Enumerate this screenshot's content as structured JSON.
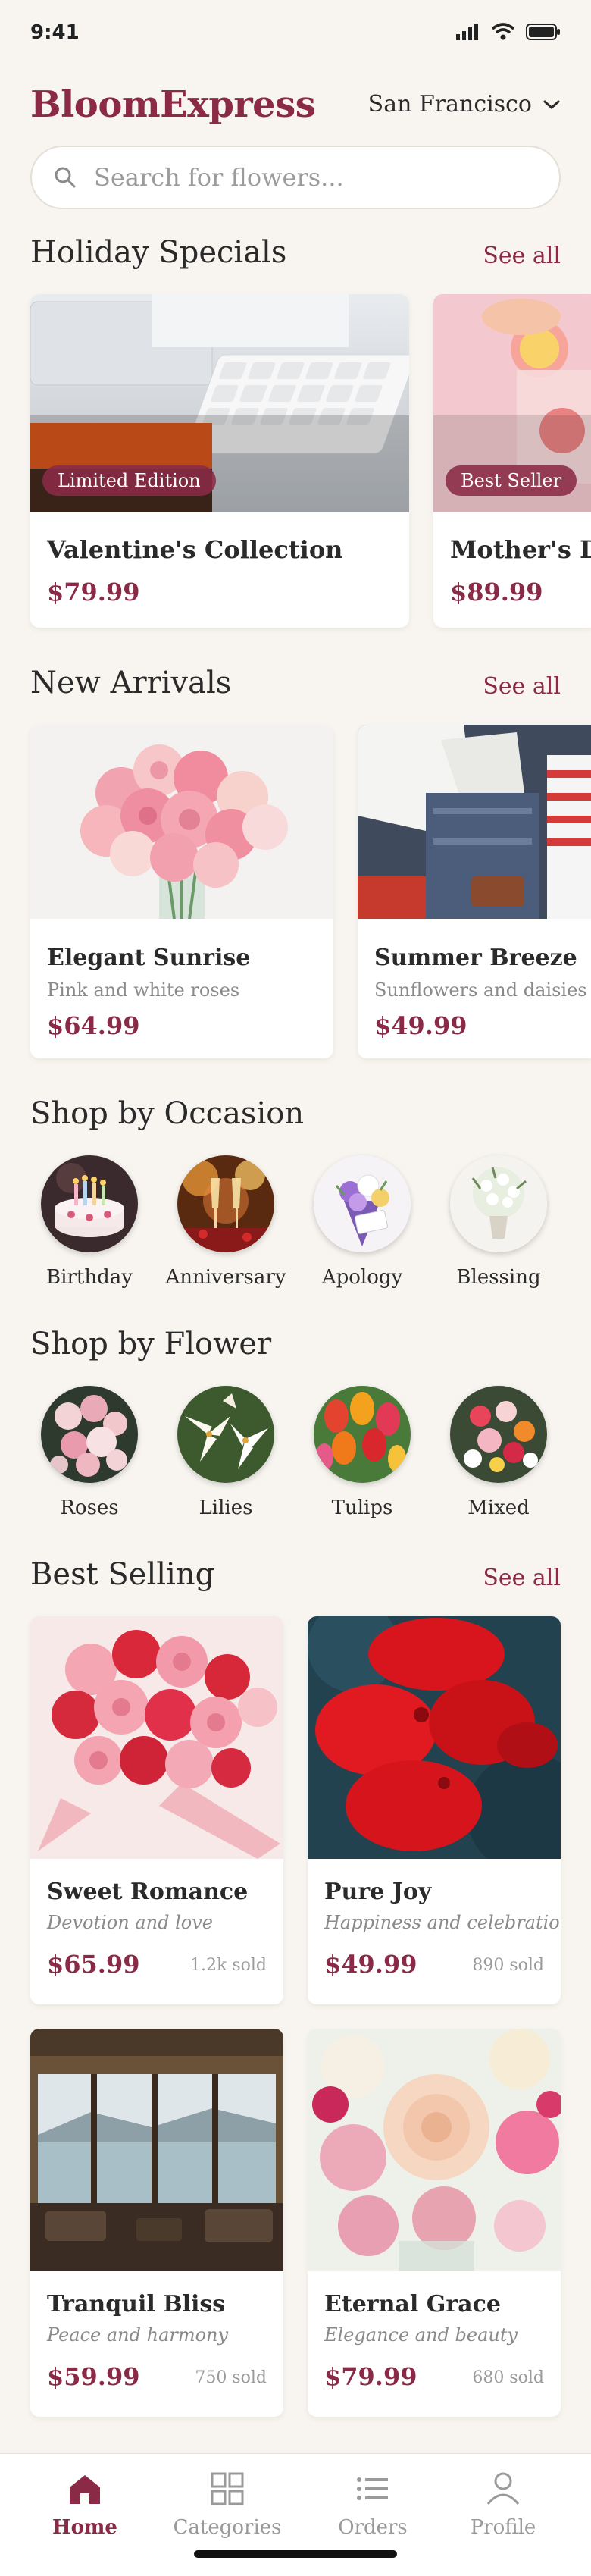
{
  "status": {
    "time": "9:41"
  },
  "header": {
    "brand": "BloomExpress",
    "location": "San Francisco"
  },
  "search": {
    "placeholder": "Search for flowers..."
  },
  "holiday": {
    "title": "Holiday Specials",
    "see_all": "See all",
    "items": [
      {
        "badge": "Limited Edition",
        "name": "Valentine's Collection",
        "price": "$79.99"
      },
      {
        "badge": "Best Seller",
        "name": "Mother's Day",
        "price": "$89.99"
      }
    ]
  },
  "arrivals": {
    "title": "New Arrivals",
    "see_all": "See all",
    "items": [
      {
        "name": "Elegant Sunrise",
        "desc": "Pink and white roses",
        "price": "$64.99"
      },
      {
        "name": "Summer Breeze",
        "desc": "Sunflowers and daisies",
        "price": "$49.99"
      }
    ]
  },
  "occasion": {
    "title": "Shop by Occasion",
    "items": [
      {
        "label": "Birthday"
      },
      {
        "label": "Anniversary"
      },
      {
        "label": "Apology"
      },
      {
        "label": "Blessing"
      }
    ]
  },
  "flower": {
    "title": "Shop by Flower",
    "items": [
      {
        "label": "Roses"
      },
      {
        "label": "Lilies"
      },
      {
        "label": "Tulips"
      },
      {
        "label": "Mixed"
      }
    ]
  },
  "best": {
    "title": "Best Selling",
    "see_all": "See all",
    "items": [
      {
        "name": "Sweet Romance",
        "tagline": "Devotion and love",
        "price": "$65.99",
        "sold": "1.2k sold"
      },
      {
        "name": "Pure Joy",
        "tagline": "Happiness and celebration",
        "price": "$49.99",
        "sold": "890 sold"
      },
      {
        "name": "Tranquil Bliss",
        "tagline": "Peace and harmony",
        "price": "$59.99",
        "sold": "750 sold"
      },
      {
        "name": "Eternal Grace",
        "tagline": "Elegance and beauty",
        "price": "$79.99",
        "sold": "680 sold"
      }
    ]
  },
  "nav": {
    "items": [
      {
        "label": "Home",
        "icon": "home-icon",
        "active": true
      },
      {
        "label": "Categories",
        "icon": "grid-icon"
      },
      {
        "label": "Orders",
        "icon": "list-icon"
      },
      {
        "label": "Profile",
        "icon": "user-icon"
      }
    ]
  },
  "colors": {
    "accent": "#8a2a46",
    "background": "#f8f5f0"
  }
}
